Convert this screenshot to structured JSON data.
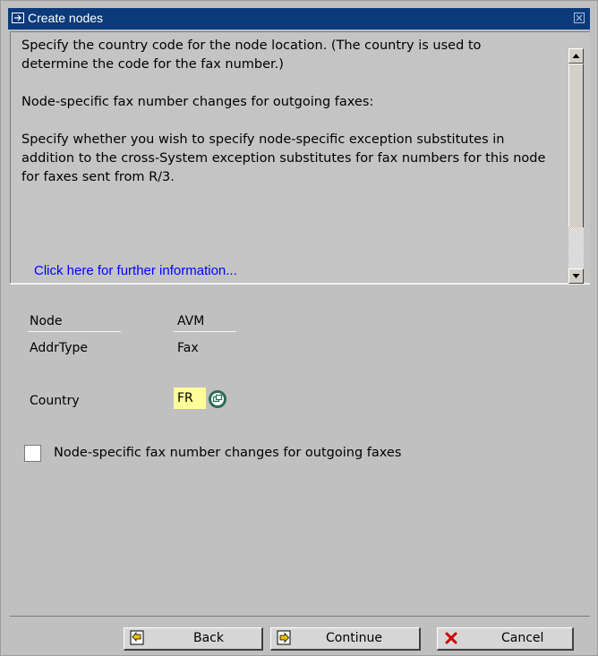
{
  "window": {
    "title": "Create nodes"
  },
  "help": {
    "paragraphs": [
      "Specify the country code for the node location. (The country is used to determine the code for the fax number.)",
      "Node-specific fax number changes for outgoing faxes:",
      "Specify whether you wish to specify node-specific exception substitutes in addition to the cross-System exception substitutes for fax numbers for this node for faxes sent from R/3."
    ],
    "link_text": "Click here for further information..."
  },
  "form": {
    "node_label": "Node",
    "node_value": "AVM",
    "addrtype_label": "AddrType",
    "addrtype_value": "Fax",
    "country_label": "Country",
    "country_value": "FR",
    "checkbox_label": "Node-specific fax number changes for outgoing faxes",
    "checkbox_checked": false
  },
  "buttons": {
    "back": "Back",
    "continue": "Continue",
    "cancel": "Cancel"
  },
  "colors": {
    "titlebar": "#0b3a7a",
    "link": "#0000ff",
    "required_field": "#ffff99"
  }
}
